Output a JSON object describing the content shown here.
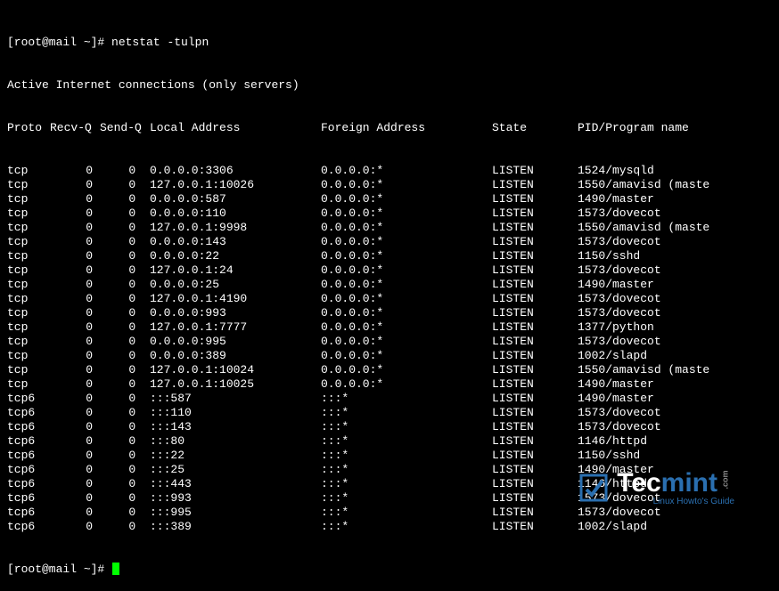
{
  "prompt": "[root@mail ~]# ",
  "command": "netstat -tulpn",
  "header_line": "Active Internet connections (only servers)",
  "columns": {
    "proto": "Proto",
    "recvq": "Recv-Q",
    "sendq": "Send-Q",
    "local": "Local Address",
    "foreign": "Foreign Address",
    "state": "State",
    "pid": "PID/Program name"
  },
  "rows": [
    {
      "proto": "tcp",
      "recvq": "0",
      "sendq": "0",
      "local": "0.0.0.0:3306",
      "foreign": "0.0.0.0:*",
      "state": "LISTEN",
      "pid": "1524/mysqld"
    },
    {
      "proto": "tcp",
      "recvq": "0",
      "sendq": "0",
      "local": "127.0.0.1:10026",
      "foreign": "0.0.0.0:*",
      "state": "LISTEN",
      "pid": "1550/amavisd (maste"
    },
    {
      "proto": "tcp",
      "recvq": "0",
      "sendq": "0",
      "local": "0.0.0.0:587",
      "foreign": "0.0.0.0:*",
      "state": "LISTEN",
      "pid": "1490/master"
    },
    {
      "proto": "tcp",
      "recvq": "0",
      "sendq": "0",
      "local": "0.0.0.0:110",
      "foreign": "0.0.0.0:*",
      "state": "LISTEN",
      "pid": "1573/dovecot"
    },
    {
      "proto": "tcp",
      "recvq": "0",
      "sendq": "0",
      "local": "127.0.0.1:9998",
      "foreign": "0.0.0.0:*",
      "state": "LISTEN",
      "pid": "1550/amavisd (maste"
    },
    {
      "proto": "tcp",
      "recvq": "0",
      "sendq": "0",
      "local": "0.0.0.0:143",
      "foreign": "0.0.0.0:*",
      "state": "LISTEN",
      "pid": "1573/dovecot"
    },
    {
      "proto": "tcp",
      "recvq": "0",
      "sendq": "0",
      "local": "0.0.0.0:22",
      "foreign": "0.0.0.0:*",
      "state": "LISTEN",
      "pid": "1150/sshd"
    },
    {
      "proto": "tcp",
      "recvq": "0",
      "sendq": "0",
      "local": "127.0.0.1:24",
      "foreign": "0.0.0.0:*",
      "state": "LISTEN",
      "pid": "1573/dovecot"
    },
    {
      "proto": "tcp",
      "recvq": "0",
      "sendq": "0",
      "local": "0.0.0.0:25",
      "foreign": "0.0.0.0:*",
      "state": "LISTEN",
      "pid": "1490/master"
    },
    {
      "proto": "tcp",
      "recvq": "0",
      "sendq": "0",
      "local": "127.0.0.1:4190",
      "foreign": "0.0.0.0:*",
      "state": "LISTEN",
      "pid": "1573/dovecot"
    },
    {
      "proto": "tcp",
      "recvq": "0",
      "sendq": "0",
      "local": "0.0.0.0:993",
      "foreign": "0.0.0.0:*",
      "state": "LISTEN",
      "pid": "1573/dovecot"
    },
    {
      "proto": "tcp",
      "recvq": "0",
      "sendq": "0",
      "local": "127.0.0.1:7777",
      "foreign": "0.0.0.0:*",
      "state": "LISTEN",
      "pid": "1377/python"
    },
    {
      "proto": "tcp",
      "recvq": "0",
      "sendq": "0",
      "local": "0.0.0.0:995",
      "foreign": "0.0.0.0:*",
      "state": "LISTEN",
      "pid": "1573/dovecot"
    },
    {
      "proto": "tcp",
      "recvq": "0",
      "sendq": "0",
      "local": "0.0.0.0:389",
      "foreign": "0.0.0.0:*",
      "state": "LISTEN",
      "pid": "1002/slapd"
    },
    {
      "proto": "tcp",
      "recvq": "0",
      "sendq": "0",
      "local": "127.0.0.1:10024",
      "foreign": "0.0.0.0:*",
      "state": "LISTEN",
      "pid": "1550/amavisd (maste"
    },
    {
      "proto": "tcp",
      "recvq": "0",
      "sendq": "0",
      "local": "127.0.0.1:10025",
      "foreign": "0.0.0.0:*",
      "state": "LISTEN",
      "pid": "1490/master"
    },
    {
      "proto": "tcp6",
      "recvq": "0",
      "sendq": "0",
      "local": ":::587",
      "foreign": ":::*",
      "state": "LISTEN",
      "pid": "1490/master"
    },
    {
      "proto": "tcp6",
      "recvq": "0",
      "sendq": "0",
      "local": ":::110",
      "foreign": ":::*",
      "state": "LISTEN",
      "pid": "1573/dovecot"
    },
    {
      "proto": "tcp6",
      "recvq": "0",
      "sendq": "0",
      "local": ":::143",
      "foreign": ":::*",
      "state": "LISTEN",
      "pid": "1573/dovecot"
    },
    {
      "proto": "tcp6",
      "recvq": "0",
      "sendq": "0",
      "local": ":::80",
      "foreign": ":::*",
      "state": "LISTEN",
      "pid": "1146/httpd"
    },
    {
      "proto": "tcp6",
      "recvq": "0",
      "sendq": "0",
      "local": ":::22",
      "foreign": ":::*",
      "state": "LISTEN",
      "pid": "1150/sshd"
    },
    {
      "proto": "tcp6",
      "recvq": "0",
      "sendq": "0",
      "local": ":::25",
      "foreign": ":::*",
      "state": "LISTEN",
      "pid": "1490/master"
    },
    {
      "proto": "tcp6",
      "recvq": "0",
      "sendq": "0",
      "local": ":::443",
      "foreign": ":::*",
      "state": "LISTEN",
      "pid": "1146/httpd"
    },
    {
      "proto": "tcp6",
      "recvq": "0",
      "sendq": "0",
      "local": ":::993",
      "foreign": ":::*",
      "state": "LISTEN",
      "pid": "1573/dovecot"
    },
    {
      "proto": "tcp6",
      "recvq": "0",
      "sendq": "0",
      "local": ":::995",
      "foreign": ":::*",
      "state": "LISTEN",
      "pid": "1573/dovecot"
    },
    {
      "proto": "tcp6",
      "recvq": "0",
      "sendq": "0",
      "local": ":::389",
      "foreign": ":::*",
      "state": "LISTEN",
      "pid": "1002/slapd"
    }
  ],
  "prompt2": "[root@mail ~]# ",
  "logo": {
    "main_prefix": "Tec",
    "main_suffix": "mint",
    "com": ".com",
    "sub": "Linux Howto's Guide"
  }
}
